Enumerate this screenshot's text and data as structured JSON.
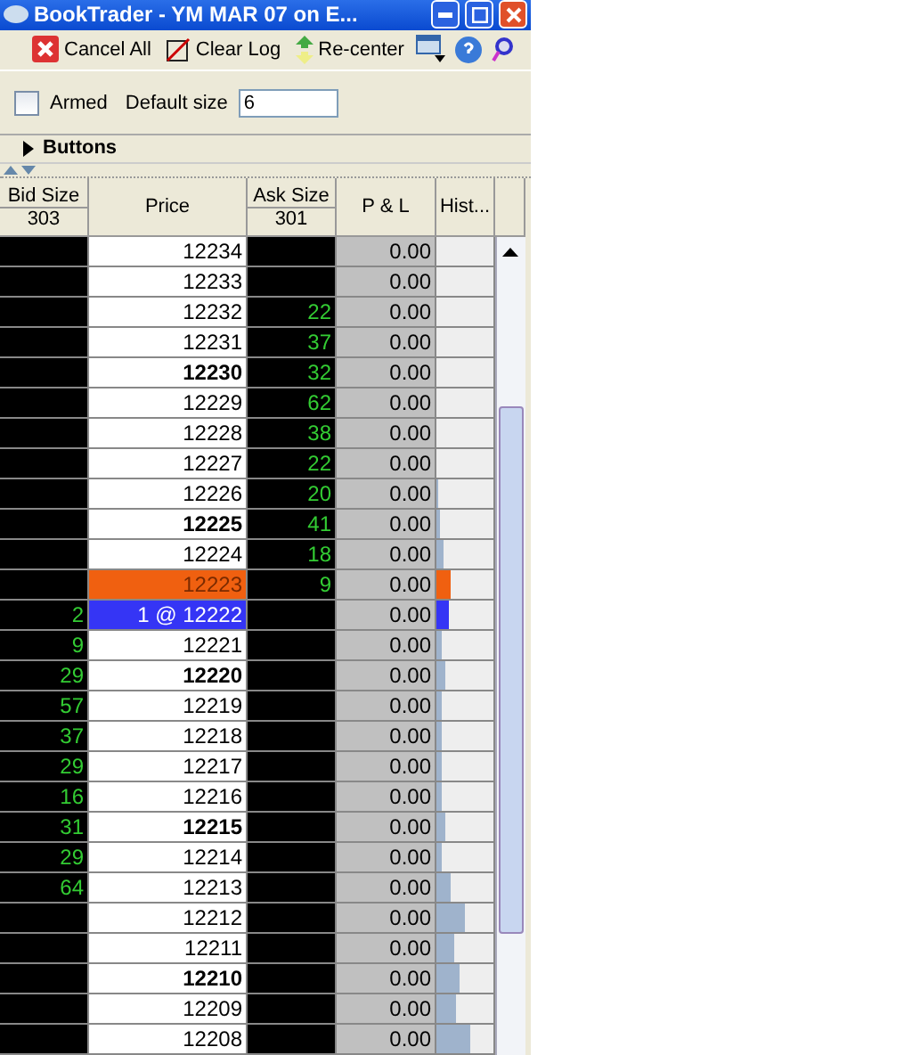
{
  "window": {
    "title": "BookTrader - YM   MAR 07 on E..."
  },
  "toolbar": [
    {
      "label": "Cancel All",
      "kind": "cancel"
    },
    {
      "label": "Clear Log",
      "kind": "clear"
    },
    {
      "label": "Re-center",
      "kind": "recenter"
    }
  ],
  "options": {
    "armed": {
      "label": "Armed",
      "checked": false
    },
    "default_size": {
      "label": "Default size",
      "value": "6"
    }
  },
  "buttons_section": {
    "label": "Buttons",
    "expanded": false
  },
  "table": {
    "columns": [
      {
        "label": "Bid Size",
        "total": "303"
      },
      {
        "label": "Price"
      },
      {
        "label": "Ask Size",
        "total": "301"
      },
      {
        "label": "P & L"
      },
      {
        "label": "Hist..."
      }
    ],
    "rows": [
      {
        "bid": "",
        "price": "12234",
        "ask": "",
        "pnl": "0.00",
        "bold": false,
        "kind": "normal"
      },
      {
        "bid": "",
        "price": "12233",
        "ask": "",
        "pnl": "0.00",
        "bold": false,
        "kind": "normal"
      },
      {
        "bid": "",
        "price": "12232",
        "ask": "22",
        "pnl": "0.00",
        "bold": false,
        "kind": "normal"
      },
      {
        "bid": "",
        "price": "12231",
        "ask": "37",
        "pnl": "0.00",
        "bold": false,
        "kind": "normal"
      },
      {
        "bid": "",
        "price": "12230",
        "ask": "32",
        "pnl": "0.00",
        "bold": true,
        "kind": "normal"
      },
      {
        "bid": "",
        "price": "12229",
        "ask": "62",
        "pnl": "0.00",
        "bold": false,
        "kind": "normal"
      },
      {
        "bid": "",
        "price": "12228",
        "ask": "38",
        "pnl": "0.00",
        "bold": false,
        "kind": "normal"
      },
      {
        "bid": "",
        "price": "12227",
        "ask": "22",
        "pnl": "0.00",
        "bold": false,
        "kind": "normal"
      },
      {
        "bid": "",
        "price": "12226",
        "ask": "20",
        "pnl": "0.00",
        "bold": false,
        "kind": "normal",
        "level": 0.03
      },
      {
        "bid": "",
        "price": "12225",
        "ask": "41",
        "pnl": "0.00",
        "bold": true,
        "kind": "normal",
        "level": 0.06
      },
      {
        "bid": "",
        "price": "12224",
        "ask": "18",
        "pnl": "0.00",
        "bold": false,
        "kind": "normal",
        "level": 0.12
      },
      {
        "bid": "",
        "price": "12223",
        "ask": "9",
        "pnl": "0.00",
        "bold": false,
        "kind": "last",
        "level": 0.25
      },
      {
        "bid": "2",
        "price": "1 @ 12222",
        "ask": "",
        "pnl": "0.00",
        "bold": false,
        "kind": "order",
        "level": 0.22
      },
      {
        "bid": "9",
        "price": "12221",
        "ask": "",
        "pnl": "0.00",
        "bold": false,
        "kind": "normal",
        "level": 0.1
      },
      {
        "bid": "29",
        "price": "12220",
        "ask": "",
        "pnl": "0.00",
        "bold": true,
        "kind": "normal",
        "level": 0.15
      },
      {
        "bid": "57",
        "price": "12219",
        "ask": "",
        "pnl": "0.00",
        "bold": false,
        "kind": "normal",
        "level": 0.1
      },
      {
        "bid": "37",
        "price": "12218",
        "ask": "",
        "pnl": "0.00",
        "bold": false,
        "kind": "normal",
        "level": 0.08
      },
      {
        "bid": "29",
        "price": "12217",
        "ask": "",
        "pnl": "0.00",
        "bold": false,
        "kind": "normal",
        "level": 0.1
      },
      {
        "bid": "16",
        "price": "12216",
        "ask": "",
        "pnl": "0.00",
        "bold": false,
        "kind": "normal",
        "level": 0.1
      },
      {
        "bid": "31",
        "price": "12215",
        "ask": "",
        "pnl": "0.00",
        "bold": true,
        "kind": "normal",
        "level": 0.15
      },
      {
        "bid": "29",
        "price": "12214",
        "ask": "",
        "pnl": "0.00",
        "bold": false,
        "kind": "normal",
        "level": 0.1
      },
      {
        "bid": "64",
        "price": "12213",
        "ask": "",
        "pnl": "0.00",
        "bold": false,
        "kind": "normal",
        "level": 0.25
      },
      {
        "bid": "",
        "price": "12212",
        "ask": "",
        "pnl": "0.00",
        "bold": false,
        "kind": "normal",
        "level": 0.5
      },
      {
        "bid": "",
        "price": "12211",
        "ask": "",
        "pnl": "0.00",
        "bold": false,
        "kind": "normal",
        "level": 0.3
      },
      {
        "bid": "",
        "price": "12210",
        "ask": "",
        "pnl": "0.00",
        "bold": true,
        "kind": "normal",
        "level": 0.4
      },
      {
        "bid": "",
        "price": "12209",
        "ask": "",
        "pnl": "0.00",
        "bold": false,
        "kind": "normal",
        "level": 0.35
      },
      {
        "bid": "",
        "price": "12208",
        "ask": "",
        "pnl": "0.00",
        "bold": false,
        "kind": "normal",
        "level": 0.6
      }
    ]
  }
}
